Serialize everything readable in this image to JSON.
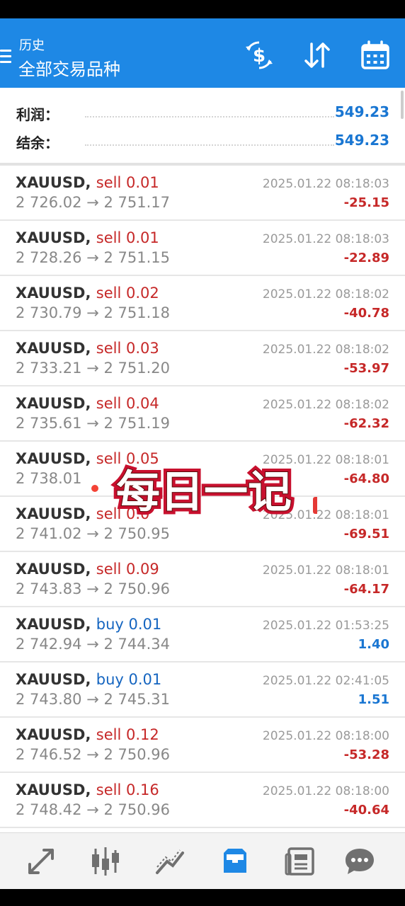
{
  "header": {
    "subtitle": "历史",
    "title": "全部交易品种",
    "icons": [
      "menu-icon",
      "currency-exchange-icon",
      "sort-icon",
      "calendar-icon"
    ]
  },
  "summary": {
    "profit_label": "利润：",
    "profit_value": "549.23",
    "balance_label": "结余：",
    "balance_value": "549.23"
  },
  "trades": [
    {
      "symbol": "XAUUSD,",
      "side": "sell 0.01",
      "type": "sell",
      "prices": "2 726.02 → 2 751.17",
      "time": "2025.01.22 08:18:03",
      "profit": "-25.15"
    },
    {
      "symbol": "XAUUSD,",
      "side": "sell 0.01",
      "type": "sell",
      "prices": "2 728.26 → 2 751.15",
      "time": "2025.01.22 08:18:03",
      "profit": "-22.89"
    },
    {
      "symbol": "XAUUSD,",
      "side": "sell 0.02",
      "type": "sell",
      "prices": "2 730.79 → 2 751.18",
      "time": "2025.01.22 08:18:02",
      "profit": "-40.78"
    },
    {
      "symbol": "XAUUSD,",
      "side": "sell 0.03",
      "type": "sell",
      "prices": "2 733.21 → 2 751.20",
      "time": "2025.01.22 08:18:02",
      "profit": "-53.97"
    },
    {
      "symbol": "XAUUSD,",
      "side": "sell 0.04",
      "type": "sell",
      "prices": "2 735.61 → 2 751.19",
      "time": "2025.01.22 08:18:02",
      "profit": "-62.32"
    },
    {
      "symbol": "XAUUSD,",
      "side": "sell 0.05",
      "type": "sell",
      "prices": "2 738.01",
      "time": "2025.01.22 08:18:01",
      "profit": "-64.80"
    },
    {
      "symbol": "XAUUSD,",
      "side": "sell 0.0",
      "type": "sell",
      "prices": "2 741.02 → 2 750.95",
      "time": "2025.01.22 08:18:01",
      "profit": "-69.51"
    },
    {
      "symbol": "XAUUSD,",
      "side": "sell 0.09",
      "type": "sell",
      "prices": "2 743.83 → 2 750.96",
      "time": "2025.01.22 08:18:01",
      "profit": "-64.17"
    },
    {
      "symbol": "XAUUSD,",
      "side": "buy 0.01",
      "type": "buy",
      "prices": "2 742.94 → 2 744.34",
      "time": "2025.01.22 01:53:25",
      "profit": "1.40"
    },
    {
      "symbol": "XAUUSD,",
      "side": "buy 0.01",
      "type": "buy",
      "prices": "2 743.80 → 2 745.31",
      "time": "2025.01.22 02:41:05",
      "profit": "1.51"
    },
    {
      "symbol": "XAUUSD,",
      "side": "sell 0.12",
      "type": "sell",
      "prices": "2 746.52 → 2 750.96",
      "time": "2025.01.22 08:18:00",
      "profit": "-53.28"
    },
    {
      "symbol": "XAUUSD,",
      "side": "sell 0.16",
      "type": "sell",
      "prices": "2 748.42 → 2 750.96",
      "time": "2025.01.22 08:18:00",
      "profit": "-40.64"
    }
  ],
  "overlay_sticker": {
    "text": "每日一记"
  },
  "colors": {
    "header": "#1e88e5",
    "sell": "#c62828",
    "buy": "#1565c0",
    "profit_positive": "#1976d2",
    "active_nav": "#1e88e5"
  },
  "bottom_nav": {
    "items": [
      "quotes-icon",
      "chart-icon",
      "trade-icon",
      "history-icon",
      "news-icon",
      "messages-icon"
    ],
    "active": "history-icon"
  }
}
